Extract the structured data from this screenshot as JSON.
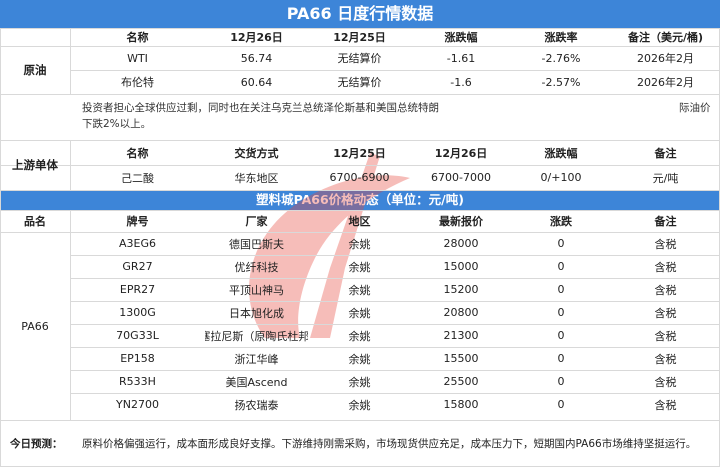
{
  "title": "PA66 日度行情数据",
  "crude": {
    "label": "原油",
    "headers": [
      "名称",
      "12月26日",
      "12月25日",
      "涨跌幅",
      "涨跌率",
      "备注（美元/桶)"
    ],
    "rows": [
      [
        "WTI",
        "56.74",
        "无结算价",
        "-1.61",
        "-2.76%",
        "2026年2月"
      ],
      [
        "布伦特",
        "60.64",
        "无结算价",
        "-1.6",
        "-2.57%",
        "2026年2月"
      ]
    ],
    "note_line1": "投资者担心全球供应过剩，同时也在关注乌克兰总统泽伦斯基和美国总统特朗",
    "note_line1_tail": "际油价",
    "note_line2": "下跌2%以上。"
  },
  "upstream": {
    "label": "上游单体",
    "headers": [
      "名称",
      "交货方式",
      "12月25日",
      "12月26日",
      "涨跌幅",
      "备注"
    ],
    "row": [
      "己二酸",
      "华东地区",
      "6700-6900",
      "6700-7000",
      "0/+100",
      "元/吨"
    ]
  },
  "section_title": "塑料城PA66价格动态（单位：元/吨)",
  "pa66": {
    "headers": [
      "品名",
      "牌号",
      "厂家",
      "地区",
      "最新报价",
      "涨跌",
      "备注"
    ],
    "product": "PA66",
    "rows": [
      [
        "A3EG6",
        "德国巴斯夫",
        "余姚",
        "28000",
        "0",
        "含税"
      ],
      [
        "GR27",
        "优纤科技",
        "余姚",
        "15000",
        "0",
        "含税"
      ],
      [
        "EPR27",
        "平顶山神马",
        "余姚",
        "15200",
        "0",
        "含税"
      ],
      [
        "1300G",
        "日本旭化成",
        "余姚",
        "20800",
        "0",
        "含税"
      ],
      [
        "70G33L",
        "塞拉尼斯（原陶氏杜邦)",
        "余姚",
        "21300",
        "0",
        "含税"
      ],
      [
        "EP158",
        "浙江华峰",
        "余姚",
        "15500",
        "0",
        "含税"
      ],
      [
        "R533H",
        "美国Ascend",
        "余姚",
        "25500",
        "0",
        "含税"
      ],
      [
        "YN2700",
        "扬农瑞泰",
        "余姚",
        "15800",
        "0",
        "含税"
      ]
    ]
  },
  "forecast": {
    "label": "今日预测：",
    "text": "原料价格偏强运行，成本面形成良好支撑。下游维持刚需采购，市场现货供应充足，成本压力下，短期国内PA66市场维持坚挺运行。"
  },
  "colors": {
    "banner": "#3d85d8",
    "watermark": "#e8443a",
    "grid": "#d9d9d9"
  }
}
